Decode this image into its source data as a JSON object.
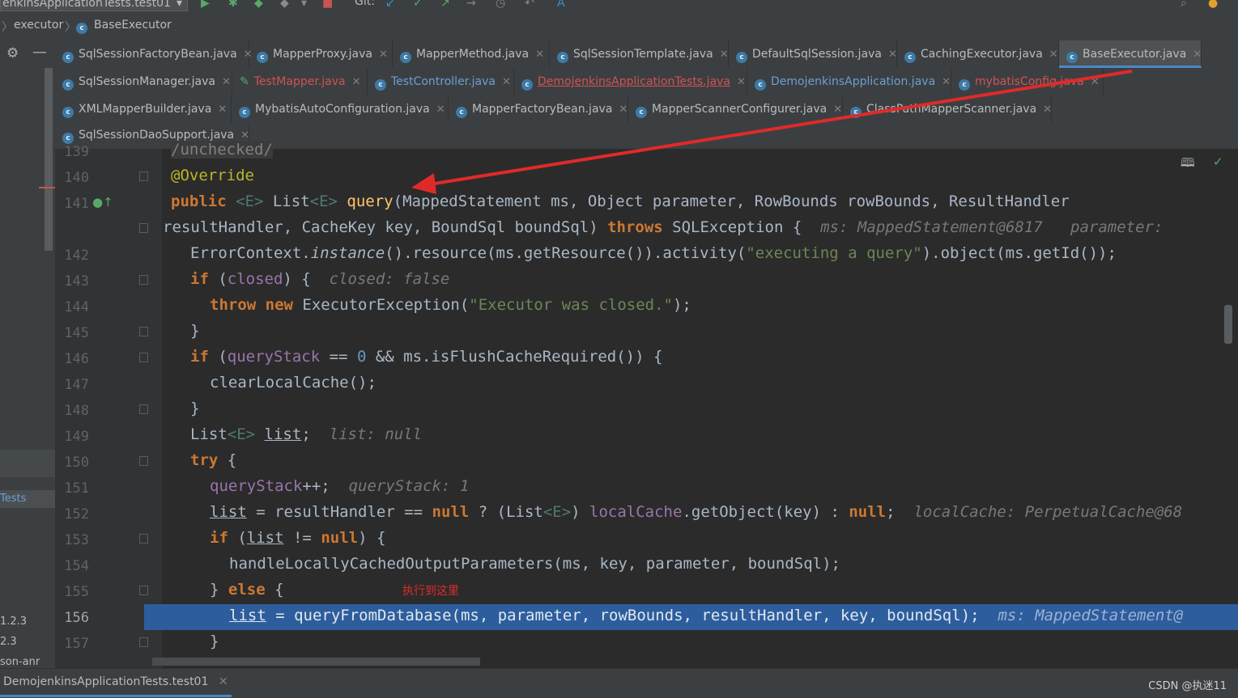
{
  "toolbar": {
    "run_config": "enkinsApplicationTests.test01",
    "git_label": "Git:"
  },
  "breadcrumb": {
    "items": [
      "executor",
      "BaseExecutor"
    ]
  },
  "tabs": {
    "row1": [
      {
        "label": "SqlSessionFactoryBean.java"
      },
      {
        "label": "MapperProxy.java"
      },
      {
        "label": "MapperMethod.java"
      },
      {
        "label": "SqlSessionTemplate.java"
      },
      {
        "label": "DefaultSqlSession.java"
      },
      {
        "label": "CachingExecutor.java"
      },
      {
        "label": "BaseExecutor.java"
      }
    ],
    "row2": [
      {
        "label": "SqlSessionManager.java"
      },
      {
        "label": "TestMapper.java"
      },
      {
        "label": "TestController.java"
      },
      {
        "label": "DemojenkinsApplicationTests.java"
      },
      {
        "label": "DemojenkinsApplication.java"
      },
      {
        "label": "mybatisConfig.java"
      }
    ],
    "row3": [
      {
        "label": "XMLMapperBuilder.java"
      },
      {
        "label": "MybatisAutoConfiguration.java"
      },
      {
        "label": "MapperFactoryBean.java"
      },
      {
        "label": "MapperScannerConfigurer.java"
      },
      {
        "label": "ClassPathMapperScanner.java"
      }
    ],
    "row4": [
      {
        "label": "SqlSessionDaoSupport.java"
      }
    ]
  },
  "editor": {
    "line_numbers": [
      "139",
      "140",
      "141",
      "142",
      "143",
      "144",
      "145",
      "146",
      "147",
      "148",
      "149",
      "150",
      "151",
      "152",
      "153",
      "154",
      "155",
      "156",
      "157"
    ],
    "current_line": "156",
    "inline_hints": {
      "l141": "ms: MappedStatement@6817   parameter: ",
      "l143": "closed: false",
      "l149": "list: null",
      "l151": "queryStack: 1",
      "l152": "localCache: PerpetualCache@68",
      "l156": "ms: MappedStatement@"
    }
  },
  "project_panel": {
    "items": [
      "Tests",
      "1.2.3",
      "2.3",
      "son-anr"
    ]
  },
  "bottom": {
    "run_tab": "DemojenkinsApplicationTests.test01",
    "watermark": "CSDN @执迷11"
  },
  "annotation": {
    "text": "执行到这里",
    "color": "#e02a2a"
  },
  "colors": {
    "accent": "#4a88c7",
    "execution_highlight": "#2d5d9c",
    "keyword": "#cc7832",
    "string": "#6a8759"
  }
}
